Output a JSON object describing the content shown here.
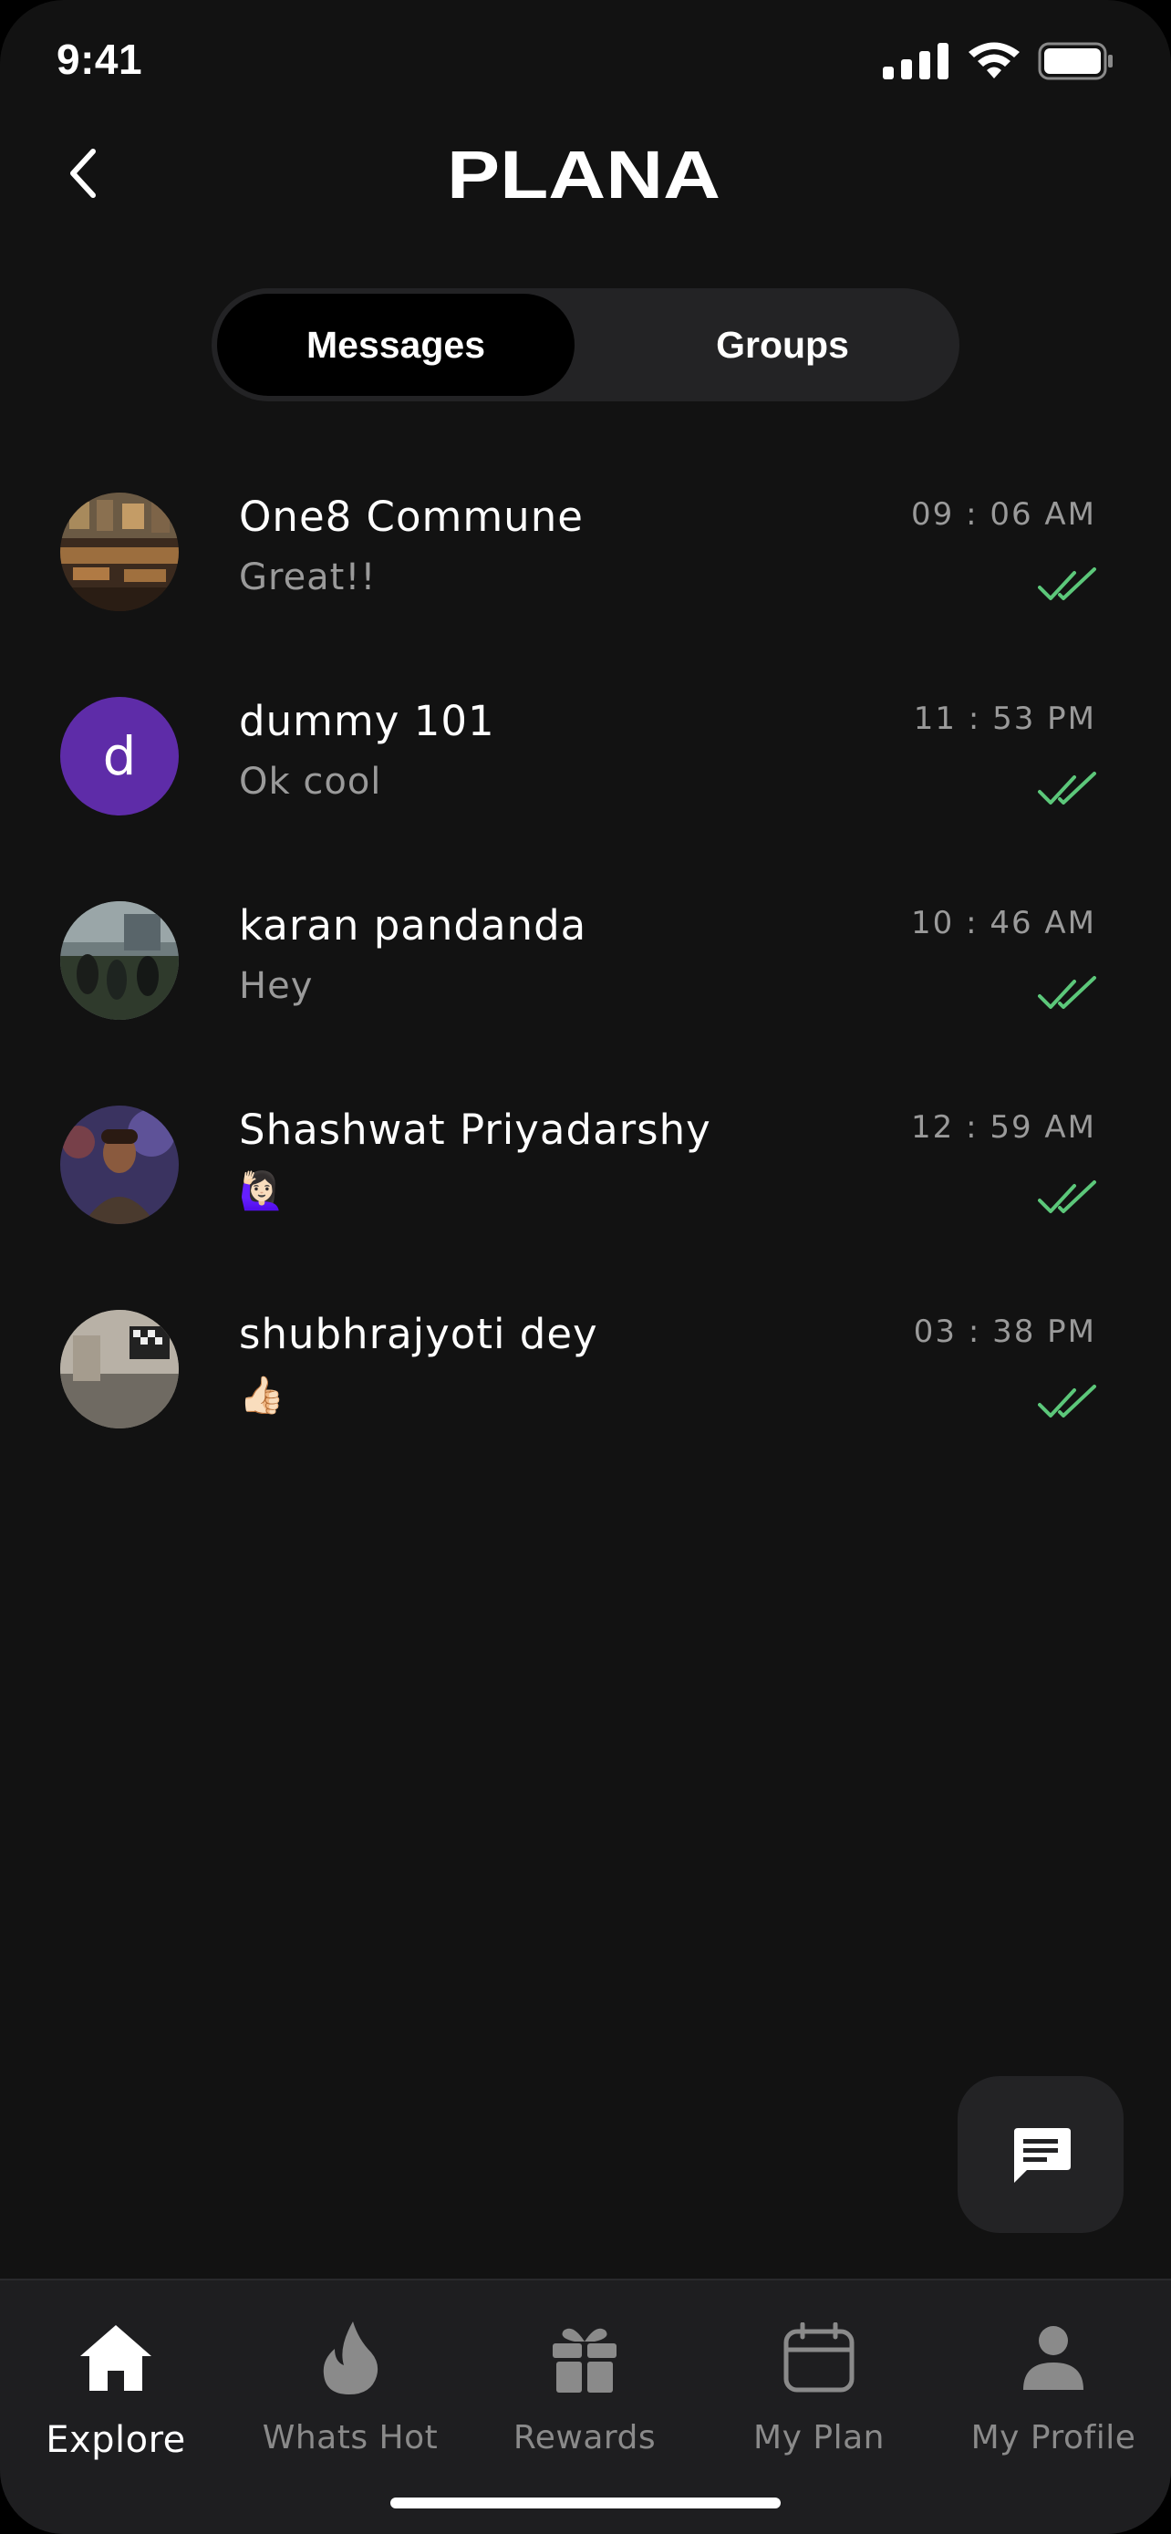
{
  "status_bar": {
    "time": "9:41"
  },
  "header": {
    "brand": "PLANA",
    "back_icon": "chevron-left-icon"
  },
  "tabs": [
    {
      "label": "Messages",
      "active": true
    },
    {
      "label": "Groups",
      "active": false
    }
  ],
  "chats": [
    {
      "name": "One8 Commune",
      "preview": "Great!!",
      "time": "09 : 06 AM",
      "avatar": "photo"
    },
    {
      "name": "dummy 101",
      "preview": "Ok cool",
      "time": "11 : 53 PM",
      "avatar": "letter",
      "avatar_letter": "d"
    },
    {
      "name": "karan pandanda",
      "preview": "Hey",
      "time": "10 : 46 AM",
      "avatar": "photo"
    },
    {
      "name": "Shashwat Priyadarshy",
      "preview": "🙋🏻‍♀️",
      "time": "12 : 59 AM",
      "avatar": "photo"
    },
    {
      "name": "shubhrajyoti dey",
      "preview": "👍🏻",
      "time": "03 : 38 PM",
      "avatar": "photo"
    }
  ],
  "colors": {
    "background": "#121212",
    "read_tick": "#5cc77a",
    "letter_avatar": "#5e2ca8",
    "surface": "#232325"
  },
  "bottom_nav": [
    {
      "label": "Explore",
      "icon": "home-icon",
      "active": true
    },
    {
      "label": "Whats Hot",
      "icon": "flame-icon",
      "active": false
    },
    {
      "label": "Rewards",
      "icon": "gift-icon",
      "active": false
    },
    {
      "label": "My Plan",
      "icon": "calendar-icon",
      "active": false
    },
    {
      "label": "My Profile",
      "icon": "person-icon",
      "active": false
    }
  ]
}
